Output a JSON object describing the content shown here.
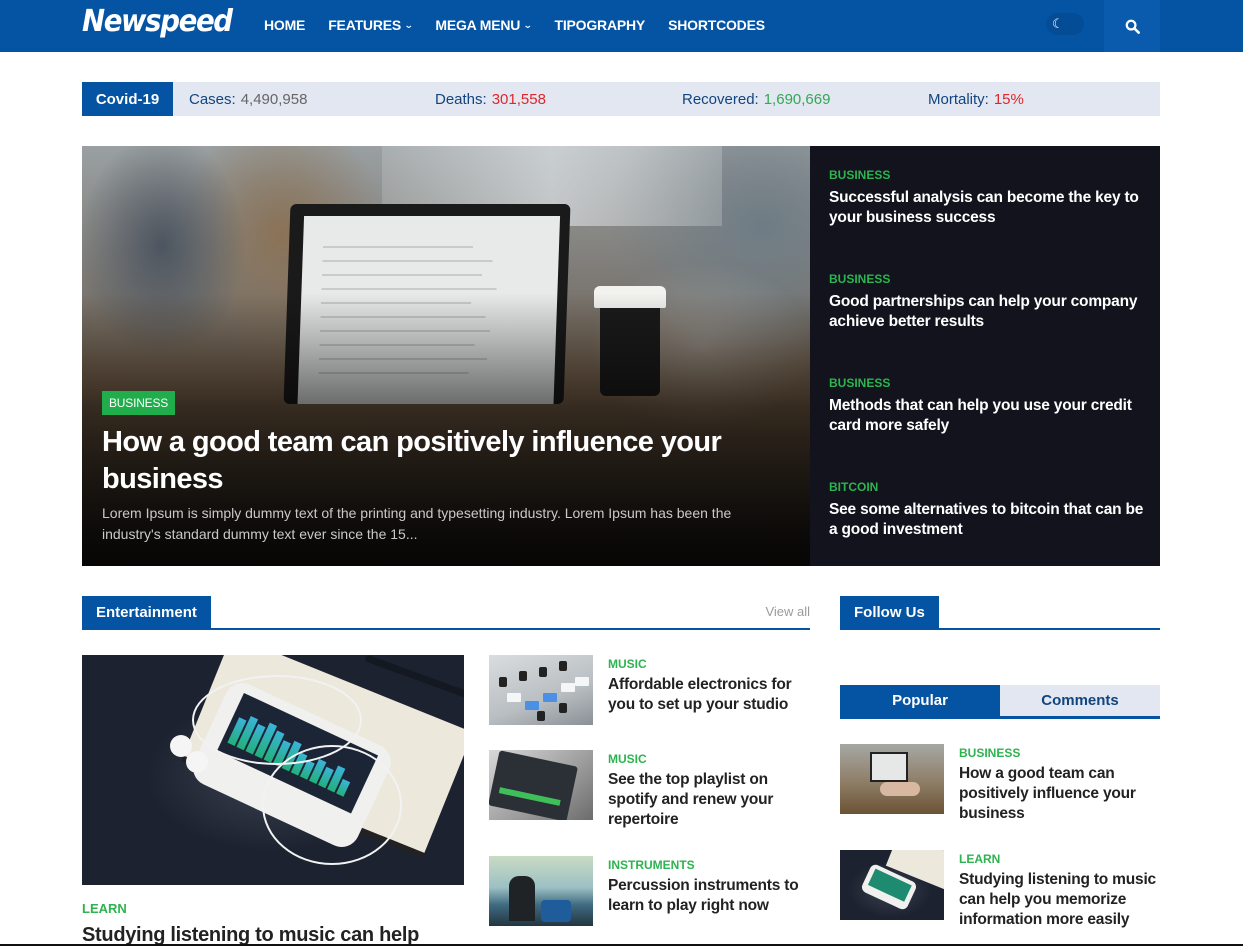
{
  "header": {
    "logo": "Newspeed",
    "nav": [
      {
        "label": "HOME",
        "has_dropdown": false
      },
      {
        "label": "FEATURES",
        "has_dropdown": true
      },
      {
        "label": "MEGA MENU",
        "has_dropdown": true
      },
      {
        "label": "TIPOGRAPHY",
        "has_dropdown": false
      },
      {
        "label": "SHORTCODES",
        "has_dropdown": false
      }
    ],
    "dark_mode_toggle_icon": "moon-icon",
    "search_icon": "search-icon"
  },
  "covid": {
    "label": "Covid-19",
    "stats": [
      {
        "label": "Cases:",
        "value": "4,490,958",
        "color": "#666666"
      },
      {
        "label": "Deaths:",
        "value": "301,558",
        "color": "#e0262a"
      },
      {
        "label": "Recovered:",
        "value": "1,690,669",
        "color": "#34a853"
      },
      {
        "label": "Mortality:",
        "value": "15%",
        "color": "#e0262a"
      }
    ]
  },
  "hero": {
    "category": "BUSINESS",
    "title": "How a good team can positively influence your business",
    "excerpt": "Lorem Ipsum is simply dummy text of the printing and typesetting industry. Lorem Ipsum has been the industry's standard dummy text ever since the 15..."
  },
  "side_list": [
    {
      "category": "BUSINESS",
      "title": "Successful analysis can become the key to your business success"
    },
    {
      "category": "BUSINESS",
      "title": "Good partnerships can help your company achieve better results"
    },
    {
      "category": "BUSINESS",
      "title": "Methods that can help you use your credit card more safely"
    },
    {
      "category": "BITCOIN",
      "title": "See some alternatives to bitcoin that can be a good investment"
    }
  ],
  "entertainment": {
    "heading": "Entertainment",
    "view_all": "View all",
    "featured": {
      "category": "LEARN",
      "title": "Studying listening to music can help"
    },
    "items": [
      {
        "category": "MUSIC",
        "title": "Affordable electronics for you to set up your studio"
      },
      {
        "category": "MUSIC",
        "title": "See the top playlist on spotify and renew your repertoire"
      },
      {
        "category": "INSTRUMENTS",
        "title": "Percussion instruments to learn to play right now"
      }
    ]
  },
  "sidebar": {
    "follow_heading": "Follow Us",
    "tabs": [
      {
        "label": "Popular",
        "active": true
      },
      {
        "label": "Comments",
        "active": false
      }
    ],
    "popular": [
      {
        "category": "BUSINESS",
        "title": "How a good team can positively influence your business"
      },
      {
        "category": "LEARN",
        "title": "Studying listening to music can help you memorize information more easily"
      }
    ]
  },
  "colors": {
    "brand_blue": "#0553a3",
    "category_green": "#2db34f",
    "dark_panel": "#12131d",
    "light_bar": "#e2e7f1"
  }
}
